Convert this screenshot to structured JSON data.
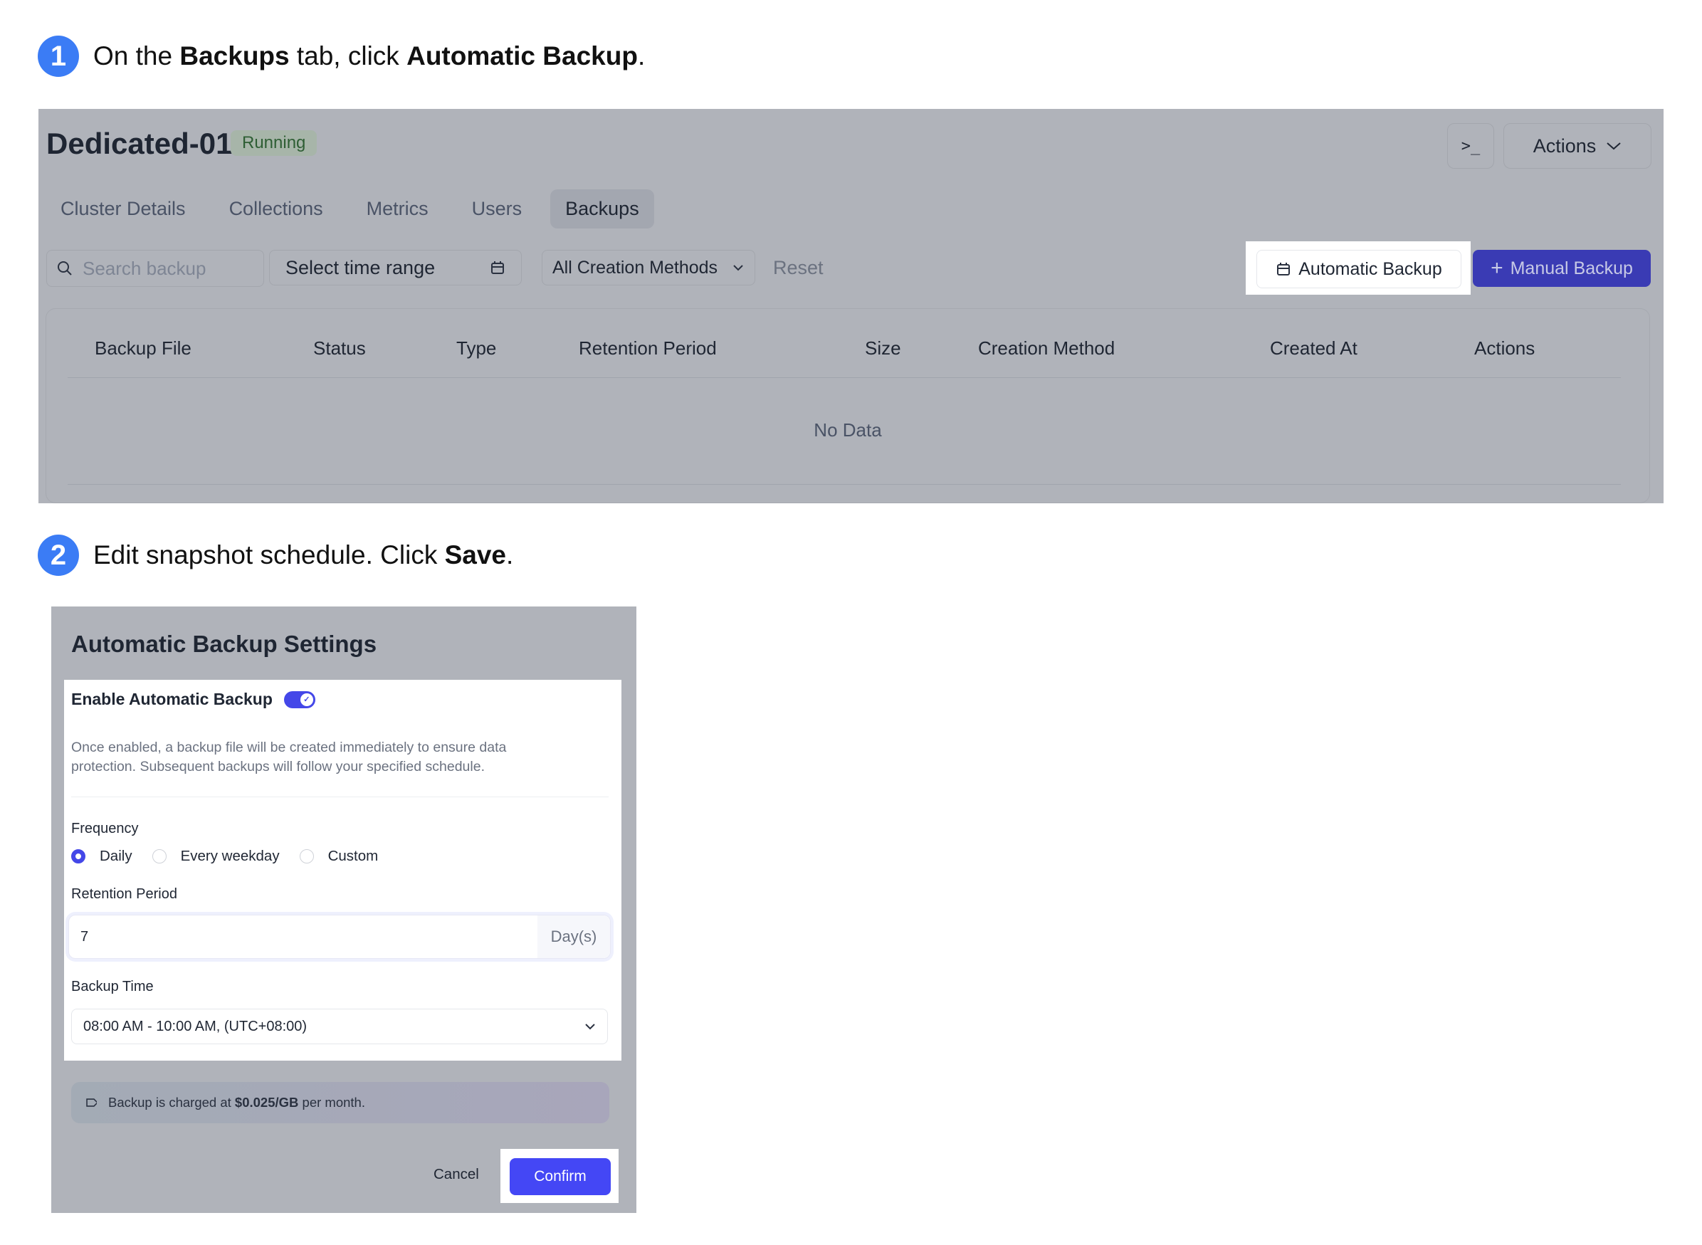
{
  "steps": [
    {
      "number": "1",
      "text_parts": [
        "On the ",
        "Backups",
        " tab, click ",
        "Automatic Backup",
        "."
      ]
    },
    {
      "number": "2",
      "text_parts": [
        "Edit snapshot schedule. Click ",
        "Save",
        "."
      ]
    }
  ],
  "cluster": {
    "title": "Dedicated-01",
    "status": "Running",
    "terminal_icon": ">_",
    "actions_label": "Actions",
    "tabs": [
      {
        "label": "Cluster Details",
        "active": false
      },
      {
        "label": "Collections",
        "active": false
      },
      {
        "label": "Metrics",
        "active": false
      },
      {
        "label": "Users",
        "active": false
      },
      {
        "label": "Backups",
        "active": true
      }
    ],
    "toolbar": {
      "search_placeholder": "Search backup",
      "time_range_placeholder": "Select time range",
      "creation_methods": "All Creation Methods",
      "reset": "Reset",
      "automatic_backup": "Automatic Backup",
      "manual_backup": "Manual Backup"
    },
    "table": {
      "columns": [
        "Backup File",
        "Status",
        "Type",
        "Retention Period",
        "Size",
        "Creation Method",
        "Created At",
        "Actions"
      ],
      "rows": [],
      "empty_text": "No Data"
    }
  },
  "dialog": {
    "title": "Automatic Backup Settings",
    "enable_label": "Enable Automatic Backup",
    "enabled": true,
    "description": "Once enabled, a backup file will be created immediately to ensure data protection. Subsequent backups will follow your specified schedule.",
    "frequency_label": "Frequency",
    "frequency_options": [
      "Daily",
      "Every weekday",
      "Custom"
    ],
    "frequency_selected": "Daily",
    "retention_label": "Retention Period",
    "retention_value": "7",
    "retention_unit": "Day(s)",
    "backup_time_label": "Backup Time",
    "backup_time_value": "08:00 AM - 10:00 AM, (UTC+08:00)",
    "charge_prefix": "Backup is charged at ",
    "charge_price": "$0.025/GB",
    "charge_suffix": " per month.",
    "cancel": "Cancel",
    "confirm": "Confirm"
  },
  "colors": {
    "step_badge": "#3b7cf5",
    "primary": "#4447f5",
    "overlay": "#b0b3ba"
  }
}
